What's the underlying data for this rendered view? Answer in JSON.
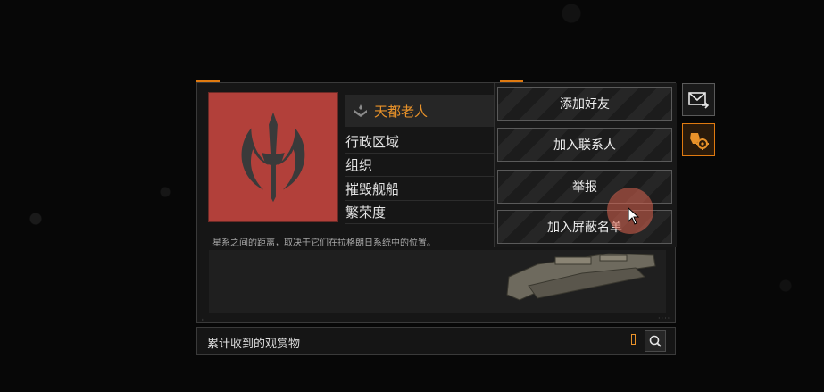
{
  "profile": {
    "name": "天都老人",
    "fields": [
      "行政区域",
      "组织",
      "摧毁舰船",
      "繁荣度"
    ],
    "description": "星系之间的距离，取决于它们在拉格朗日系统中的位置。",
    "emblem": "red-phoenix-emblem"
  },
  "menu": {
    "items": [
      "添加好友",
      "加入联系人",
      "举报",
      "加入屏蔽名单"
    ]
  },
  "side": {
    "mail_icon": "mail-forward-icon",
    "fleet_icon": "fleet-settings-icon"
  },
  "bottom": {
    "label": "累计收到的观赏物"
  },
  "colors": {
    "accent": "#e07a10",
    "emblem_bg": "#b2403a",
    "name": "#e8922a"
  }
}
